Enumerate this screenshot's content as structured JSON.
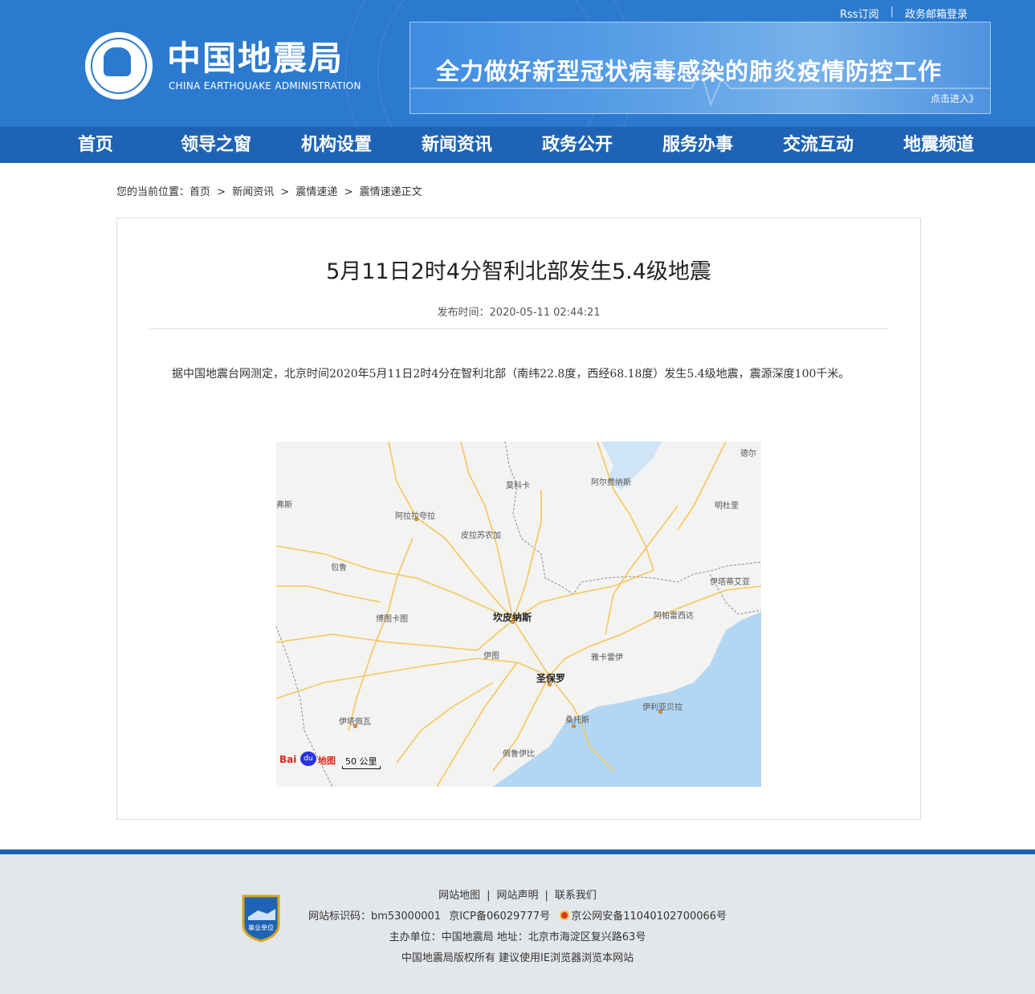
{
  "header": {
    "top_links": [
      "Rss订阅",
      "政务邮箱登录"
    ],
    "logo_cn": "中国地震局",
    "logo_en": "CHINA EARTHQUAKE ADMINISTRATION",
    "banner_title": "全力做好新型冠状病毒感染的肺炎疫情防控工作",
    "banner_link": "点击进入》"
  },
  "nav": [
    "首页",
    "领导之窗",
    "机构设置",
    "新闻资讯",
    "政务公开",
    "服务办事",
    "交流互动",
    "地震频道"
  ],
  "breadcrumb": {
    "prefix": "您的当前位置：",
    "items": [
      "首页",
      "新闻资讯",
      "震情速递",
      "震情速递正文"
    ],
    "separator": ">"
  },
  "article": {
    "title": "5月11日2时4分智利北部发生5.4级地震",
    "pubtime": "发布时间：2020-05-11 02:44:21",
    "body": "据中国地震台网测定，北京时间2020年5月11日2时4分在智利北部（南纬22.8度，西经68.18度）发生5.4级地震，震源深度100千米。"
  },
  "map": {
    "labels": {
      "l1": "德尔",
      "l2": "莫科卡",
      "l3": "阿尔费纳斯",
      "l4": "弗斯",
      "l5": "明杜里",
      "l6": "阿拉拉夸拉",
      "l7": "皮拉苏农加",
      "l8": "包鲁",
      "l9": "伊塔蒂艾亚",
      "l10": "博图卡图",
      "l11": "坎皮纳斯",
      "l12": "阿帕雷西达",
      "l13": "伊图",
      "l14": "雅卡雷伊",
      "l15": "圣保罗",
      "l16": "伊利亚贝拉",
      "l17": "伊塔佩瓦",
      "l18": "桑托斯",
      "l19": "佩鲁伊比"
    },
    "brand_b": "Bai",
    "brand_du": "du",
    "brand_map": "地图",
    "scale": "50 公里",
    "colors": {
      "land": "#f3f3f1",
      "sea": "#b3d6f3",
      "road": "#f6c65b",
      "border": "#8a8a8a"
    }
  },
  "footer": {
    "links": [
      "网站地图",
      "网站声明",
      "联系我们"
    ],
    "badge": "事业单位",
    "row1": {
      "site_id": "网站标识码：bm53000001",
      "icp": "京ICP备06029777号",
      "police": "京公网安备11040102700066号"
    },
    "row2": "主办单位：中国地震局  地址：北京市海淀区复兴路63号",
    "row3": "中国地震局版权所有  建议使用IE浏览器浏览本网站"
  }
}
